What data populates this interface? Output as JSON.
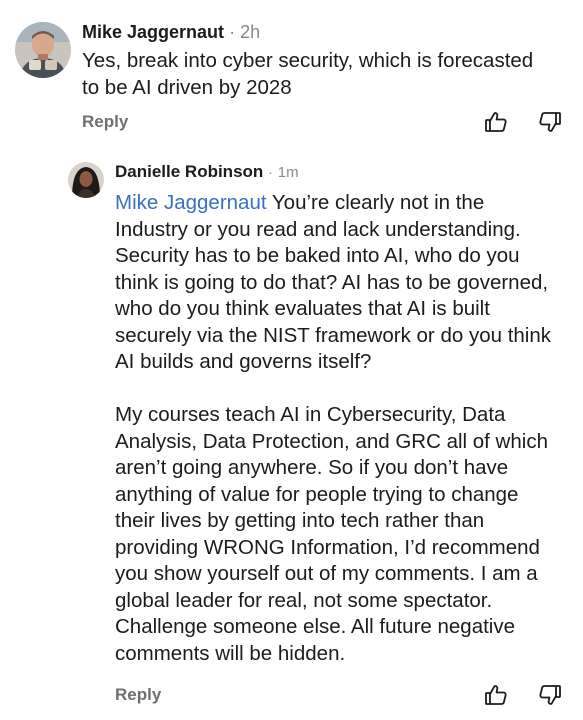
{
  "comments": [
    {
      "author": "Mike Jaggernaut",
      "separator": "·",
      "time": "2h",
      "lines": [
        "Yes, break into cyber security, which is forecasted",
        "to be AI driven by 2028"
      ],
      "reply_label": "Reply",
      "icons": {
        "upvote": "thumbs-up-icon",
        "downvote": "thumbs-down-icon"
      }
    },
    {
      "author": "Danielle Robinson",
      "separator": "·",
      "time": "1m",
      "mention": "Mike Jaggernaut",
      "paragraph1_first_line_rest": " You’re clearly not in the",
      "paragraph1_lines": [
        "Industry or you read and lack understanding.",
        "Security has to be baked into AI, who do you",
        "think is going to do that? AI has to be governed,",
        "who do you think evaluates that AI is built",
        "securely via the NIST framework or do you think",
        "AI builds and governs itself?"
      ],
      "paragraph2_lines": [
        "My courses teach AI in Cybersecurity, Data",
        "Analysis, Data Protection, and GRC all of which",
        "aren’t going anywhere. So if you don’t have",
        "anything of value for people trying to change",
        "their lives by getting into tech rather than",
        "providing WRONG Information, I’d recommend",
        "you show yourself out of my comments. I am a",
        "global leader for real, not some spectator.",
        "Challenge someone else. All future negative",
        "comments will be hidden."
      ],
      "reply_label": "Reply",
      "icons": {
        "upvote": "thumbs-up-icon",
        "downvote": "thumbs-down-icon"
      }
    }
  ],
  "colors": {
    "text": "#1c1c1e",
    "muted": "#8a8a8e",
    "mention": "#3a6fc4",
    "reply": "#707074"
  }
}
